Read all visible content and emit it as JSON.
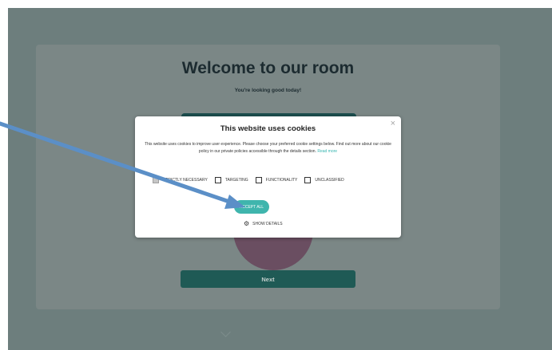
{
  "page": {
    "title": "Welcome to our room",
    "subtitle": "You're looking good today!",
    "next_label": "Next"
  },
  "cookie_dialog": {
    "title": "This website uses cookies",
    "description": "This website uses cookies to improve user experience. Please choose your preferred cookie settings below. Find out more about our cookie policy in our private policies accessible through the details section.",
    "read_more_label": "Read more",
    "close_symbol": "×",
    "options": [
      {
        "label": "STRICTLY NECESSARY",
        "checked": true
      },
      {
        "label": "TARGETING",
        "checked": false
      },
      {
        "label": "FUNCTIONALITY",
        "checked": false
      },
      {
        "label": "UNCLASSIFIED",
        "checked": false
      }
    ],
    "accept_label": "ACCEPT ALL",
    "details_label": "SHOW DETAILS",
    "details_icon": "gear-icon"
  },
  "colors": {
    "overlay": "#6d7e7d",
    "accent": "#3fb5ad",
    "next_button": "#1f5a55",
    "arrow": "#5b8fc7"
  }
}
